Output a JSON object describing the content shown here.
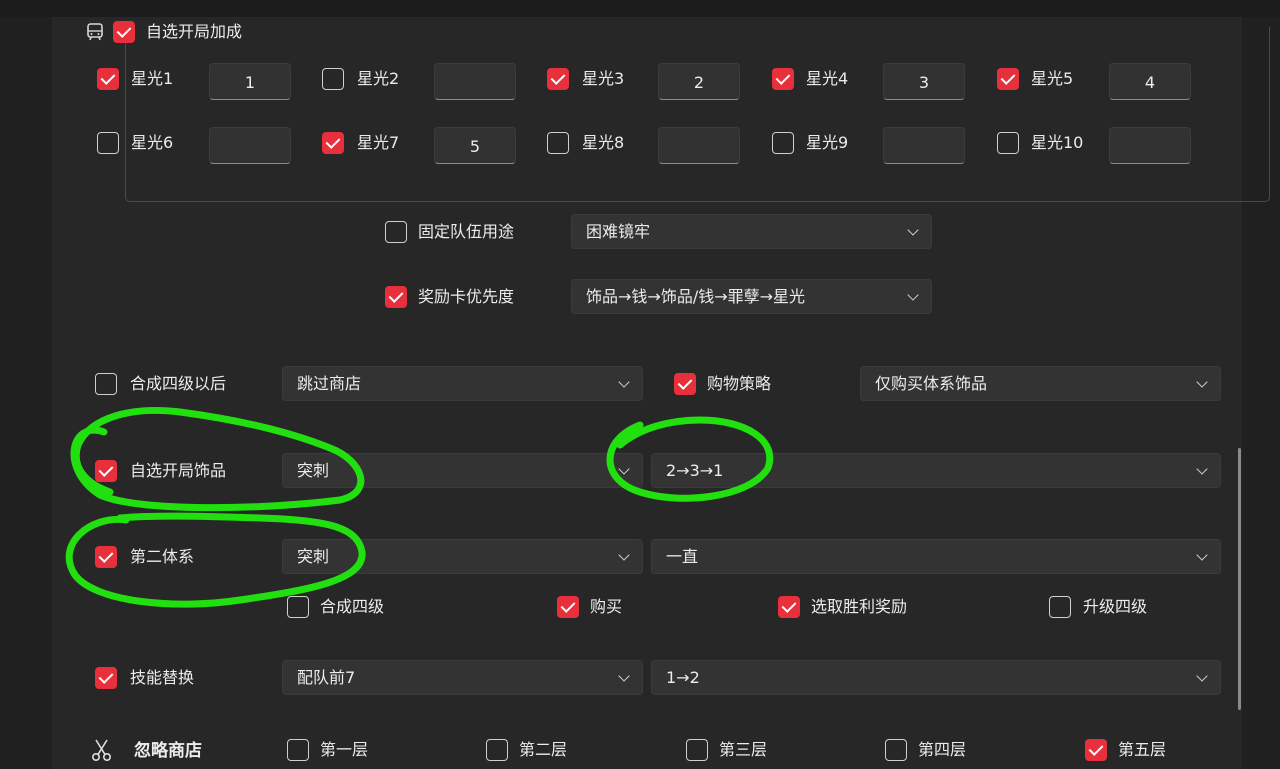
{
  "opening_bonus": {
    "label": "自选开局加成",
    "checked": true,
    "icon": "bus-icon"
  },
  "stars": [
    {
      "label": "星光1",
      "checked": true,
      "value": "1"
    },
    {
      "label": "星光2",
      "checked": false,
      "value": ""
    },
    {
      "label": "星光3",
      "checked": true,
      "value": "2"
    },
    {
      "label": "星光4",
      "checked": true,
      "value": "3"
    },
    {
      "label": "星光5",
      "checked": true,
      "value": "4"
    },
    {
      "label": "星光6",
      "checked": false,
      "value": ""
    },
    {
      "label": "星光7",
      "checked": true,
      "value": "5"
    },
    {
      "label": "星光8",
      "checked": false,
      "value": ""
    },
    {
      "label": "星光9",
      "checked": false,
      "value": ""
    },
    {
      "label": "星光10",
      "checked": false,
      "value": ""
    }
  ],
  "fixed_team": {
    "label": "固定队伍用途",
    "checked": false,
    "value": "困难镜牢"
  },
  "reward_priority": {
    "label": "奖励卡优先度",
    "checked": true,
    "value": "饰品→钱→饰品/钱→罪孽→星光"
  },
  "merge_level4": {
    "label": "合成四级以后",
    "checked": false,
    "value": "跳过商店"
  },
  "shopping": {
    "label": "购物策略",
    "checked": true,
    "value": "仅购买体系饰品"
  },
  "opening_item": {
    "label": "自选开局饰品",
    "checked": true,
    "value": "突刺",
    "order": "2→3→1"
  },
  "second_system": {
    "label": "第二体系",
    "checked": true,
    "value": "突刺",
    "mode": "一直",
    "options": [
      {
        "label": "合成四级",
        "checked": false
      },
      {
        "label": "购买",
        "checked": true
      },
      {
        "label": "选取胜利奖励",
        "checked": true
      },
      {
        "label": "升级四级",
        "checked": false
      }
    ]
  },
  "skill_swap": {
    "label": "技能替换",
    "checked": true,
    "value": "配队前7",
    "order": "1→2"
  },
  "ignore_shop": {
    "label": "忽略商店",
    "icon": "scissors-icon",
    "floors": [
      {
        "label": "第一层",
        "checked": false
      },
      {
        "label": "第二层",
        "checked": false
      },
      {
        "label": "第三层",
        "checked": false
      },
      {
        "label": "第四层",
        "checked": false
      },
      {
        "label": "第五层",
        "checked": true
      }
    ]
  },
  "colors": {
    "accent": "#e8303c",
    "annotation": "#22e010",
    "panel": "#272727"
  }
}
